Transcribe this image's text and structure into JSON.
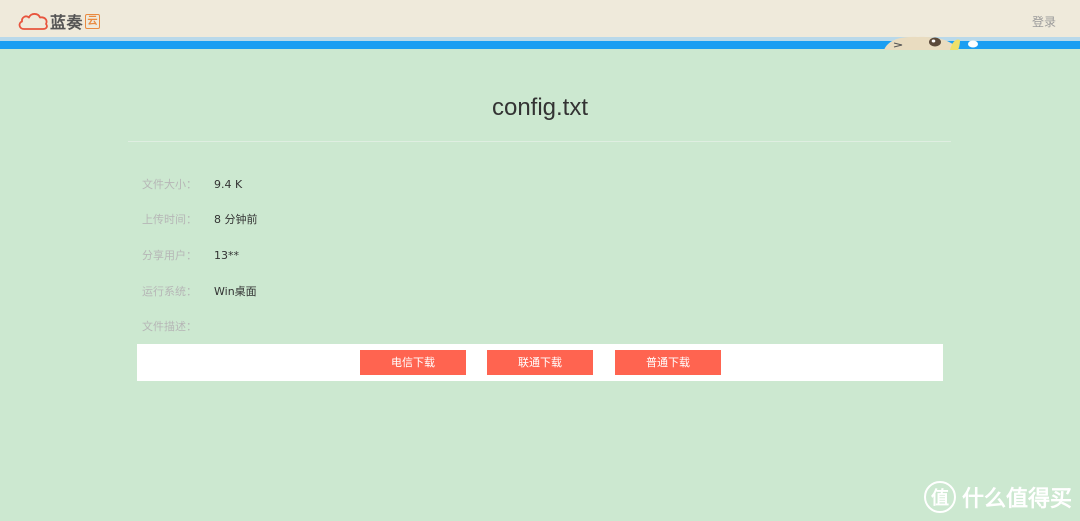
{
  "header": {
    "logo_text": "蓝奏",
    "logo_badge": "云",
    "login_label": "登录"
  },
  "file": {
    "title": "config.txt"
  },
  "info": [
    {
      "label": "文件大小：",
      "value": "9.4 K"
    },
    {
      "label": "上传时间：",
      "value": "8 分钟前"
    },
    {
      "label": "分享用户：",
      "value": "13**"
    },
    {
      "label": "运行系统：",
      "value": "Win桌面"
    },
    {
      "label": "文件描述：",
      "value": ""
    }
  ],
  "downloads": [
    {
      "label": "电信下载"
    },
    {
      "label": "联通下载"
    },
    {
      "label": "普通下载"
    }
  ],
  "watermark": {
    "icon_char": "值",
    "text": "什么值得买"
  },
  "colors": {
    "page_bg": "#cce8d0",
    "topbar_bg": "#efeadb",
    "accent_blue": "#1b9ef2",
    "button_red": "#ff6450"
  }
}
